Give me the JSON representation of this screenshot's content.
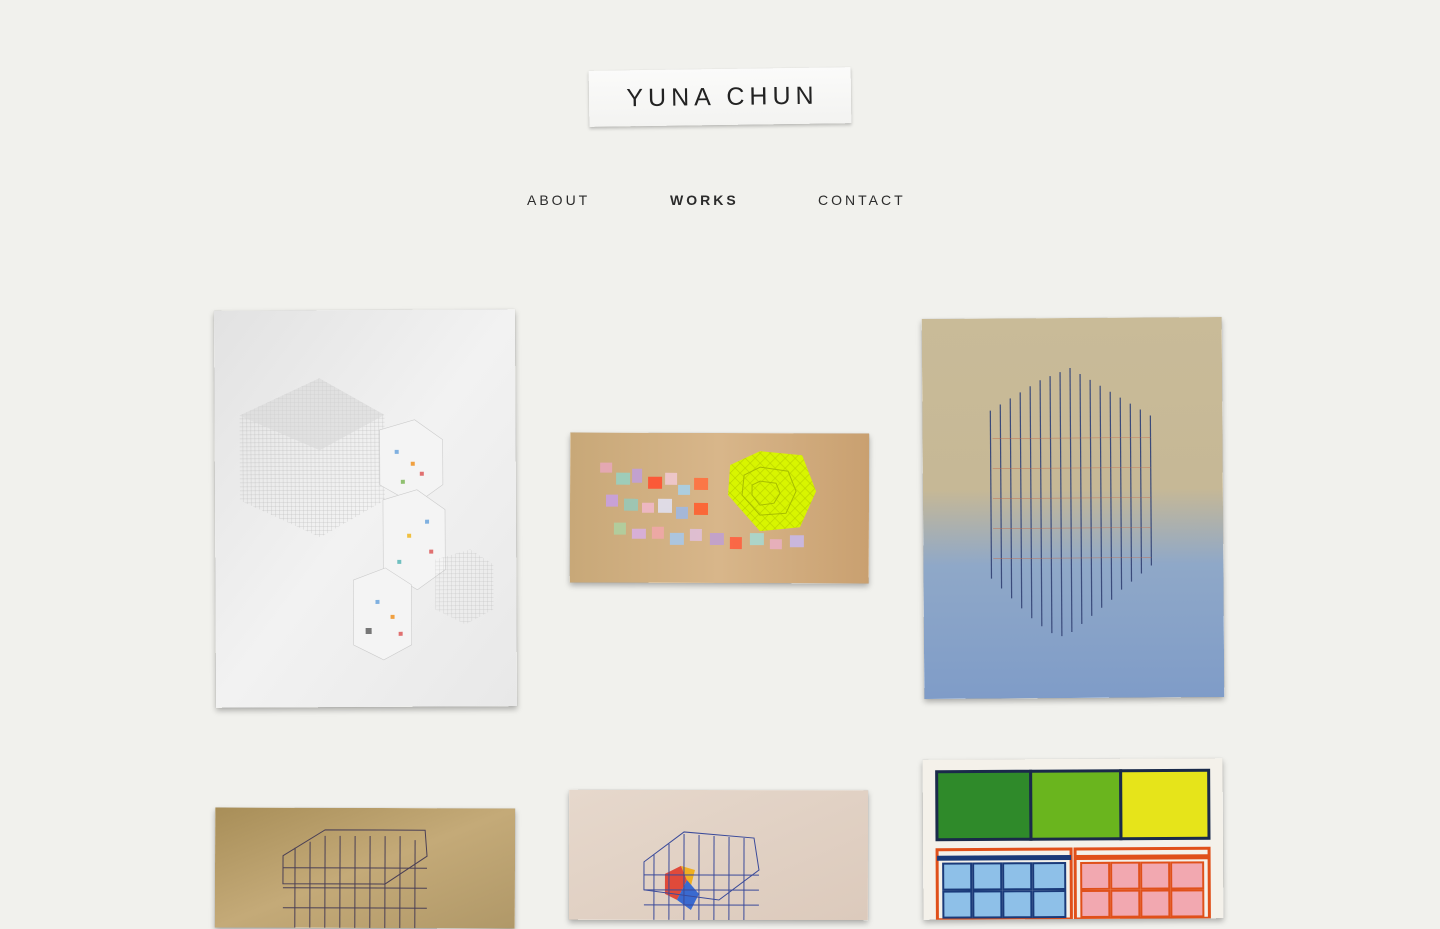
{
  "site": {
    "logo_text": "YUNA CHUN"
  },
  "nav": {
    "items": [
      {
        "label": "ABOUT",
        "active": false
      },
      {
        "label": "WORKS",
        "active": true
      },
      {
        "label": "CONTACT",
        "active": false
      }
    ]
  },
  "works": [
    {
      "name": "artwork-hexagon-drawing"
    },
    {
      "name": "artwork-neon-hexagon-collage"
    },
    {
      "name": "artwork-wire-grid-box"
    },
    {
      "name": "artwork-gold-grid-box"
    },
    {
      "name": "artwork-color-grid-box"
    },
    {
      "name": "artwork-color-blocks"
    }
  ],
  "colors": {
    "background": "#f1f1ed",
    "text": "#222222",
    "neon": "#d8f500",
    "sky_blue": "#7f9cc8"
  }
}
